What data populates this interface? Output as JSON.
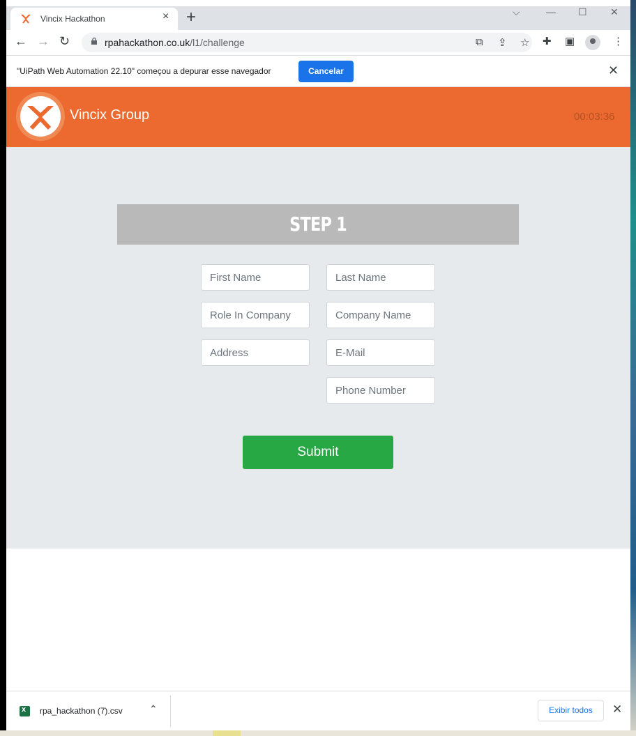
{
  "browser": {
    "tab_title": "Vincix Hackathon",
    "url_host": "rpahackathon.co.uk",
    "url_path": "/l1/challenge",
    "debug_message": "\"UiPath Web Automation 22.10\" começou a depurar esse navegador",
    "debug_cancel_label": "Cancelar"
  },
  "header": {
    "brand": "Vincix Group",
    "timer": "00:03:36"
  },
  "form": {
    "step_title": "STEP 1",
    "placeholders": {
      "first_name": "First Name",
      "last_name": "Last Name",
      "role": "Role In Company",
      "company": "Company Name",
      "address": "Address",
      "email": "E-Mail",
      "phone": "Phone Number"
    },
    "submit_label": "Submit"
  },
  "downloads": {
    "file_name": "rpa_hackathon (7).csv",
    "show_all_label": "Exibir todos"
  },
  "colors": {
    "brand_orange": "#ec6a2f",
    "submit_green": "#28a745",
    "step_gray": "#b9b9b9",
    "cancel_blue": "#1a73e8"
  }
}
